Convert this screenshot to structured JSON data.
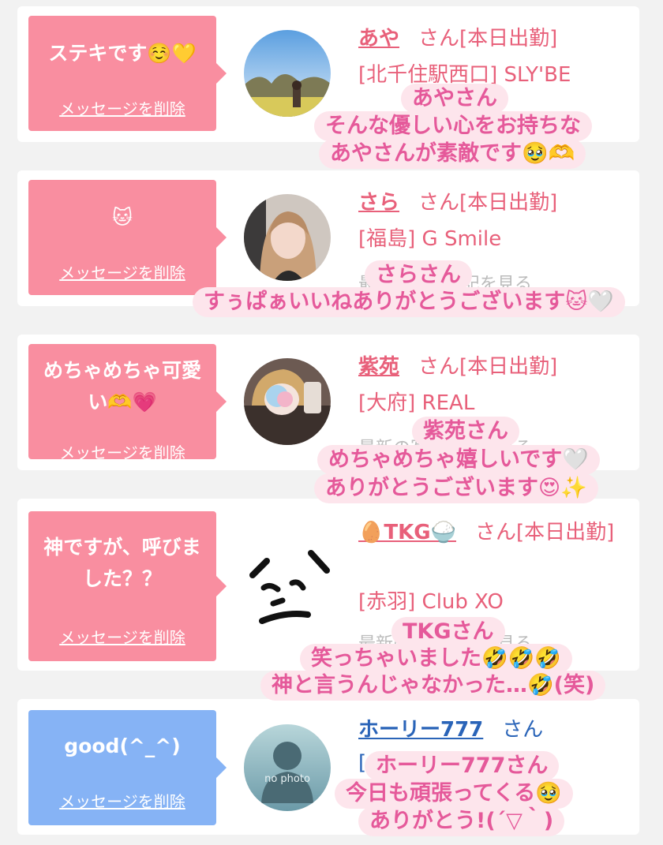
{
  "cards": [
    {
      "message": "ステキです☺️💛",
      "delete_label": "メッセージを削除",
      "name": "あや",
      "suffix": "さん[本日出勤]",
      "shop": "[北千住駅西口] SLY'BE",
      "caption": [
        "あやさん",
        "そんな優しい心をお持ちな",
        "あやさんが素敵です🥹🫶"
      ]
    },
    {
      "message": "🐱",
      "delete_label": "メッセージを削除",
      "name": "さら",
      "suffix": "さん[本日出勤]",
      "shop": "[福島] G Smile",
      "faded": "最新の写メ日記を見る",
      "caption": [
        "さらさん",
        "すぅぱぁいいねありがとうございます🐱🤍"
      ]
    },
    {
      "message": "めちゃめちゃ可愛い🫶💗",
      "delete_label": "メッセージを削除",
      "name": "紫苑",
      "suffix": "さん[本日出勤]",
      "shop": "[大府] REAL",
      "faded": "最新の写メ日記を見る",
      "caption": [
        "紫苑さん",
        "めちゃめちゃ嬉しいです🤍",
        "ありがとうございます😍✨"
      ]
    },
    {
      "message": "神ですが、呼びました？？",
      "delete_label": "メッセージを削除",
      "name": "🥚TKG🍚",
      "suffix": "さん[本日出勤]",
      "shop": "[赤羽] Club XO",
      "faded": "最新の写メ日記を見る",
      "caption": [
        "TKGさん",
        "笑っちゃいました🤣🤣🤣",
        "神と言うんじゃなかった…🤣(笑)"
      ]
    },
    {
      "message": "good(^_^)",
      "delete_label": "メッセージを削除",
      "name": "ホーリー777",
      "suffix": "さん",
      "shop": "[",
      "avatar_text": "no photo",
      "caption": [
        "ホーリー777さん",
        "今日も頑張ってくる🥹",
        "ありがとう!(´▽｀)"
      ]
    }
  ],
  "colors": {
    "pink_bubble": "#f98ea0",
    "blue_bubble": "#86b3f5",
    "name_pink": "#e8607a",
    "name_blue": "#2a64b8",
    "caption_bg": "#fde5ec",
    "caption_text": "#e5599a"
  }
}
